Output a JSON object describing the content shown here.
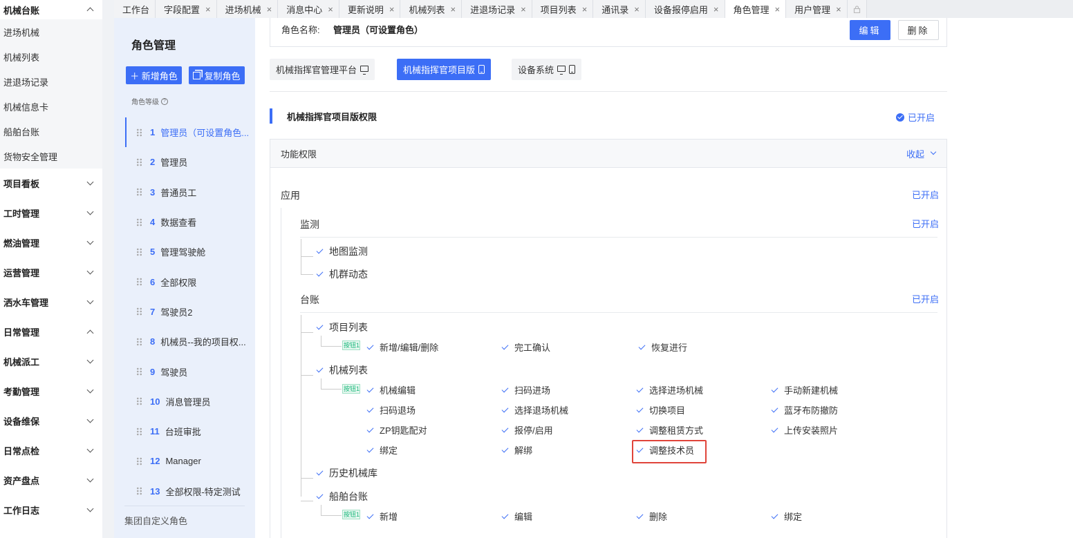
{
  "sidebar": {
    "groups_top": {
      "label": "机械台账"
    },
    "sub_items": [
      "进场机械",
      "机械列表",
      "进退场记录",
      "机械信息卡",
      "船舶台账",
      "货物安全管理"
    ],
    "groups": [
      {
        "label": "项目看板",
        "state": "down"
      },
      {
        "label": "工时管理",
        "state": "down"
      },
      {
        "label": "燃油管理",
        "state": "down"
      },
      {
        "label": "运营管理",
        "state": "down"
      },
      {
        "label": "洒水车管理",
        "state": "down"
      },
      {
        "label": "日常管理",
        "state": "up"
      },
      {
        "label": "机械派工",
        "state": "down"
      },
      {
        "label": "考勤管理",
        "state": "down"
      },
      {
        "label": "设备维保",
        "state": "down"
      },
      {
        "label": "日常点检",
        "state": "down"
      },
      {
        "label": "资产盘点",
        "state": "down"
      },
      {
        "label": "工作日志",
        "state": "down"
      }
    ]
  },
  "tabs": [
    {
      "label": "工作台",
      "closable": false
    },
    {
      "label": "字段配置",
      "closable": true
    },
    {
      "label": "进场机械",
      "closable": true
    },
    {
      "label": "消息中心",
      "closable": true
    },
    {
      "label": "更新说明",
      "closable": true
    },
    {
      "label": "机械列表",
      "closable": true
    },
    {
      "label": "进退场记录",
      "closable": true
    },
    {
      "label": "项目列表",
      "closable": true
    },
    {
      "label": "通讯录",
      "closable": true
    },
    {
      "label": "设备报停启用",
      "closable": true
    },
    {
      "label": "角色管理",
      "closable": true,
      "active": true
    },
    {
      "label": "用户管理",
      "closable": true
    }
  ],
  "tab_close_glyph": "×",
  "role_panel": {
    "title": "角色管理",
    "add_label": "＋ 新增角色",
    "copy_label": "复制角色",
    "level_label": "角色等级",
    "roles": [
      {
        "num": "1",
        "name": "管理员（可设置角色..."
      },
      {
        "num": "2",
        "name": "管理员"
      },
      {
        "num": "3",
        "name": "普通员工"
      },
      {
        "num": "4",
        "name": "数据查看"
      },
      {
        "num": "5",
        "name": "管理驾驶舱"
      },
      {
        "num": "6",
        "name": "全部权限"
      },
      {
        "num": "7",
        "name": "驾驶员2"
      },
      {
        "num": "8",
        "name": "机械员--我的项目权..."
      },
      {
        "num": "9",
        "name": "驾驶员"
      },
      {
        "num": "10",
        "name": "消息管理员"
      },
      {
        "num": "11",
        "name": "台班审批"
      },
      {
        "num": "12",
        "name": "Manager"
      },
      {
        "num": "13",
        "name": "全部权限-特定测试"
      }
    ],
    "footer": "集团自定义角色"
  },
  "main": {
    "role_name_label": "角色名称:",
    "role_name_value": "管理员（可设置角色）",
    "edit_label": "编辑",
    "delete_label": "删除",
    "platform_tabs": [
      {
        "label": "机械指挥官管理平台",
        "icons": [
          "monitor-icon"
        ]
      },
      {
        "label": "机械指挥官项目版",
        "icons": [
          "phone-icon"
        ],
        "active": true
      },
      {
        "label": "设备系统",
        "icons": [
          "monitor-icon",
          "phone-icon"
        ]
      }
    ],
    "section_title": "机械指挥官项目版权限",
    "section_status": "已开启",
    "func_label": "功能权限",
    "collapse_label": "收起",
    "app_label": "应用",
    "enabled": "已开启",
    "monitor_label": "监测",
    "monitor_items": [
      "地图监测",
      "机群动态"
    ],
    "ledger_label": "台账",
    "button_tag": "按钮1",
    "project_list_label": "项目列表",
    "project_buttons": [
      "新增/编辑/删除",
      "完工确认",
      "恢复进行"
    ],
    "mech_list_label": "机械列表",
    "mech_buttons": [
      "机械编辑",
      "扫码进场",
      "选择进场机械",
      "手动新建机械",
      "扫码退场",
      "选择退场机械",
      "切换项目",
      "蓝牙布防撤防",
      "ZP钥匙配对",
      "报停/启用",
      "调整租赁方式",
      "上传安装照片",
      "绑定",
      "解绑",
      "调整技术员"
    ],
    "history_label": "历史机械库",
    "ship_label": "船舶台账",
    "ship_buttons": [
      "新增",
      "编辑",
      "删除",
      "绑定"
    ]
  }
}
